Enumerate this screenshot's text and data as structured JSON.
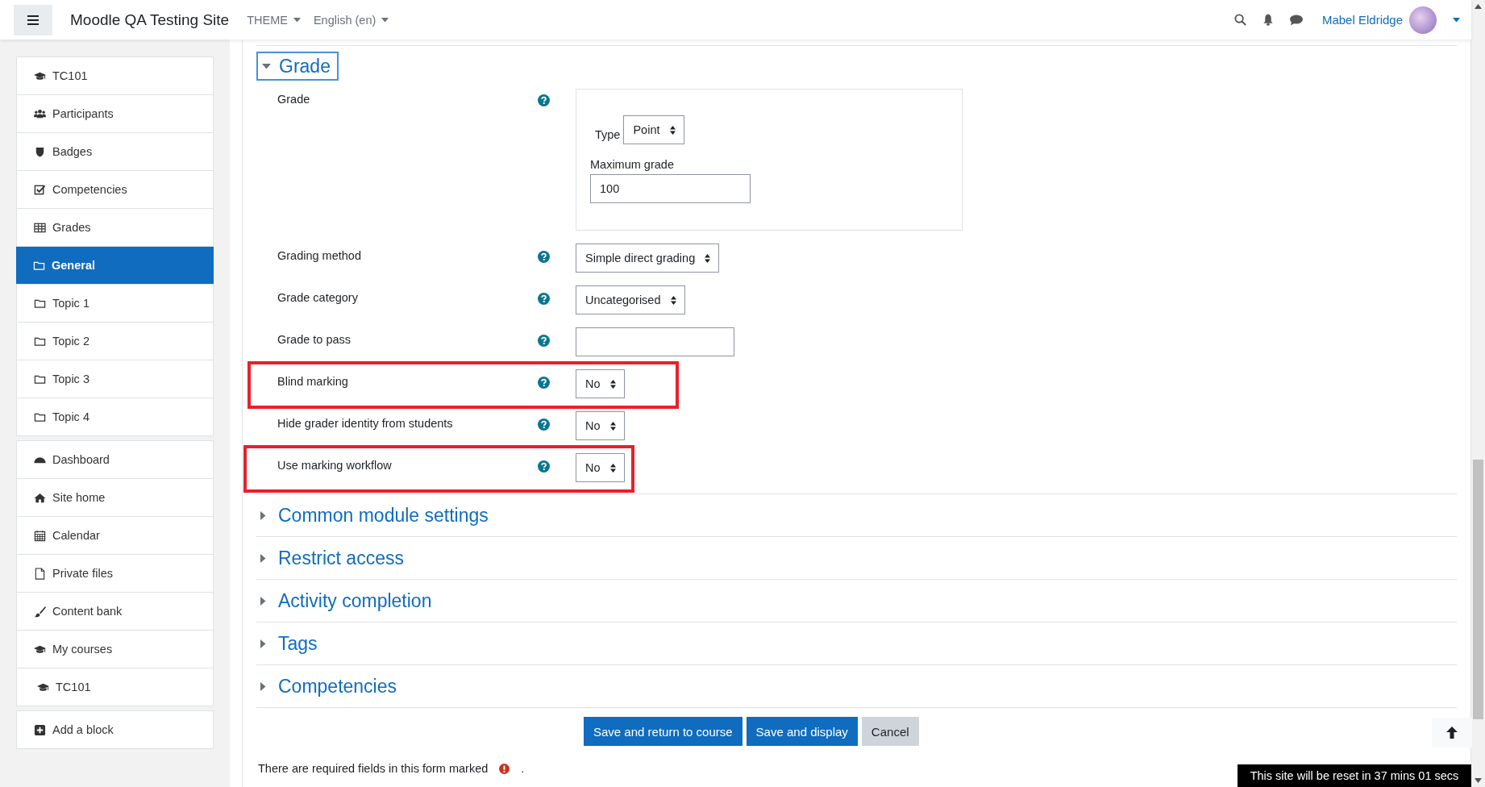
{
  "navbar": {
    "site_name": "Moodle QA Testing Site",
    "menus": [
      "THEME",
      "English (en)"
    ],
    "user_name": "Mabel Eldridge"
  },
  "sidebar": {
    "blocks": [
      {
        "items": [
          {
            "label": "TC101",
            "selected": false
          },
          {
            "label": "Participants",
            "selected": false
          },
          {
            "label": "Badges",
            "selected": false
          },
          {
            "label": "Competencies",
            "selected": false
          },
          {
            "label": "Grades",
            "selected": false
          },
          {
            "label": "General",
            "selected": true
          },
          {
            "label": "Topic 1",
            "selected": false
          },
          {
            "label": "Topic 2",
            "selected": false
          },
          {
            "label": "Topic 3",
            "selected": false
          },
          {
            "label": "Topic 4",
            "selected": false
          }
        ]
      },
      {
        "items": [
          {
            "label": "Dashboard",
            "selected": false
          },
          {
            "label": "Site home",
            "selected": false
          },
          {
            "label": "Calendar",
            "selected": false
          },
          {
            "label": "Private files",
            "selected": false
          },
          {
            "label": "Content bank",
            "selected": false
          },
          {
            "label": "My courses",
            "selected": false,
            "children": [
              {
                "label": "TC101",
                "selected": false
              }
            ]
          }
        ]
      },
      {
        "items": [
          {
            "label": "Add a block",
            "selected": false
          }
        ]
      }
    ]
  },
  "form": {
    "sections": [
      {
        "title": "Grade",
        "expanded": true,
        "fields": [
          {
            "kind": "grade-group",
            "label": "Grade",
            "highlighted": false,
            "type_label": "Type",
            "type_value": "Point",
            "max_label": "Maximum grade",
            "max_value": "100"
          },
          {
            "kind": "select",
            "label": "Grading method",
            "highlighted": false,
            "value": "Simple direct grading"
          },
          {
            "kind": "select",
            "label": "Grade category",
            "highlighted": false,
            "value": "Uncategorised"
          },
          {
            "kind": "text",
            "label": "Grade to pass",
            "highlighted": false
          },
          {
            "kind": "select",
            "label": "Blind marking",
            "highlighted": true,
            "value": "No"
          },
          {
            "kind": "select",
            "label": "Hide grader identity from students",
            "highlighted": false,
            "value": "No"
          },
          {
            "kind": "select",
            "label": "Use marking workflow",
            "highlighted": true,
            "value": "No"
          }
        ]
      },
      {
        "title": "Common module settings",
        "expanded": false
      },
      {
        "title": "Restrict access",
        "expanded": false
      },
      {
        "title": "Activity completion",
        "expanded": false
      },
      {
        "title": "Tags",
        "expanded": false
      },
      {
        "title": "Competencies",
        "expanded": false
      }
    ],
    "buttons": [
      {
        "label": "Save and return to course",
        "kind": "primary"
      },
      {
        "label": "Save and display",
        "kind": "primary"
      },
      {
        "label": "Cancel",
        "kind": "secondary"
      }
    ],
    "required_note": "There are required fields in this form marked",
    "required_note_end": "."
  },
  "reset_banner": "This site will be reset in 37 mins 01 secs"
}
